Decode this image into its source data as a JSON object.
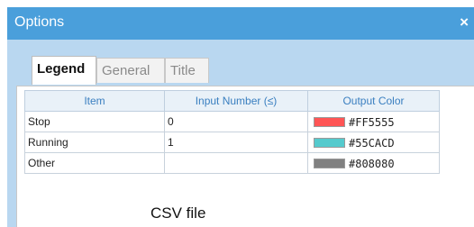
{
  "dialog": {
    "title": "Options",
    "close_label": "×",
    "tabs": [
      {
        "label": "Legend",
        "active": true
      },
      {
        "label": "General",
        "active": false
      },
      {
        "label": "Title",
        "active": false
      }
    ]
  },
  "legend_table": {
    "headers": [
      "Item",
      "Input Number (≤)",
      "Output Color"
    ],
    "rows": [
      {
        "item": "Stop",
        "input": "0",
        "color": "#FF5555"
      },
      {
        "item": "Running",
        "input": "1",
        "color": "#55CACD"
      },
      {
        "item": "Other",
        "input": "",
        "color": "#808080"
      }
    ]
  },
  "caption": "CSV file"
}
